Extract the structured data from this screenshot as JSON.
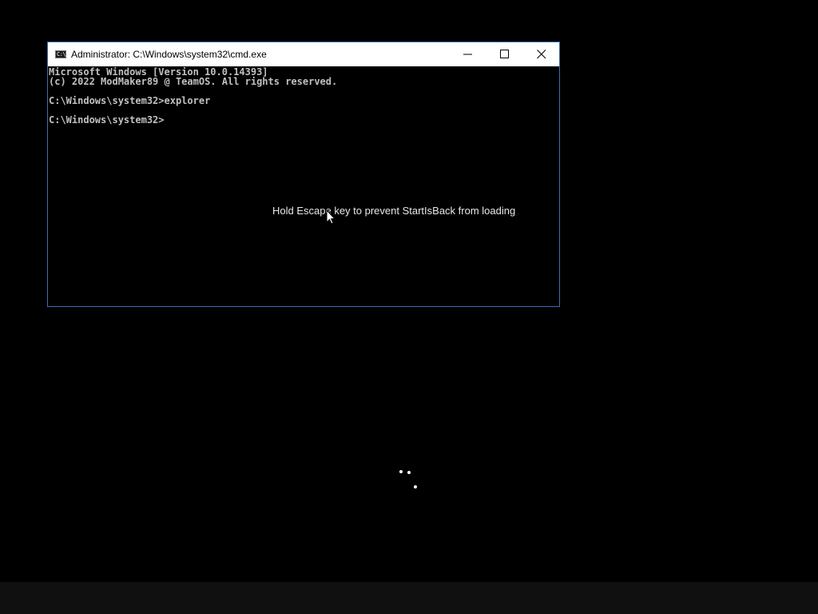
{
  "window": {
    "title": "Administrator: C:\\Windows\\system32\\cmd.exe",
    "icon": "cmd-icon",
    "icon_text": "C:\\",
    "controls": [
      "minimize-icon",
      "maximize-icon",
      "close-icon"
    ],
    "border_color": "#3c6eb4"
  },
  "console": {
    "lines": [
      "Microsoft Windows [Version 10.0.14393]",
      "(c) 2022 ModMaker89 @ TeamOS. All rights reserved.",
      "C:\\Windows\\system32>explorer",
      "C:\\Windows\\system32>"
    ],
    "text_color": "#c0c0c0",
    "background_color": "#000000"
  },
  "overlay": {
    "notice": "Hold Escape key to prevent StartIsBack from loading"
  },
  "desktop": {
    "background_color": "#000000",
    "cursor": "arrow-cursor-icon",
    "spinner": "loading-spinner-icon"
  }
}
